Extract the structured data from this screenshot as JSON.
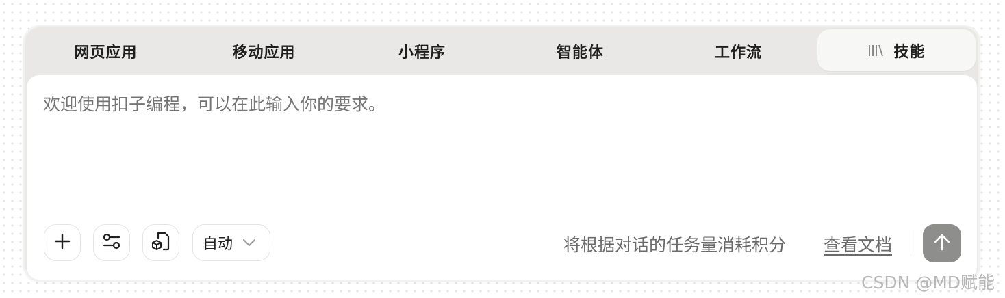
{
  "tabs": [
    {
      "label": "网页应用"
    },
    {
      "label": "移动应用"
    },
    {
      "label": "小程序"
    },
    {
      "label": "智能体"
    },
    {
      "label": "工作流"
    },
    {
      "label": "技能",
      "icon": "library-icon",
      "active": true
    }
  ],
  "prompt": {
    "placeholder": "欢迎使用扣子编程，可以在此输入你的要求。",
    "value": ""
  },
  "toolbar": {
    "add_icon": "plus-icon",
    "settings_icon": "sliders-icon",
    "file_icon": "file-cube-icon",
    "mode_label": "自动",
    "mode_icon": "chevron-down-icon",
    "credits_note": "将根据对话的任务量消耗积分",
    "docs_link": "查看文档",
    "send_icon": "arrow-up-icon"
  },
  "colors": {
    "panel_bg": "#e9e8e6",
    "card_bg": "#ffffff",
    "send_bg": "#8e8e8c",
    "muted_text": "#6b6b6b",
    "placeholder_text": "#9a9a9a"
  },
  "watermark": "CSDN @MD赋能"
}
